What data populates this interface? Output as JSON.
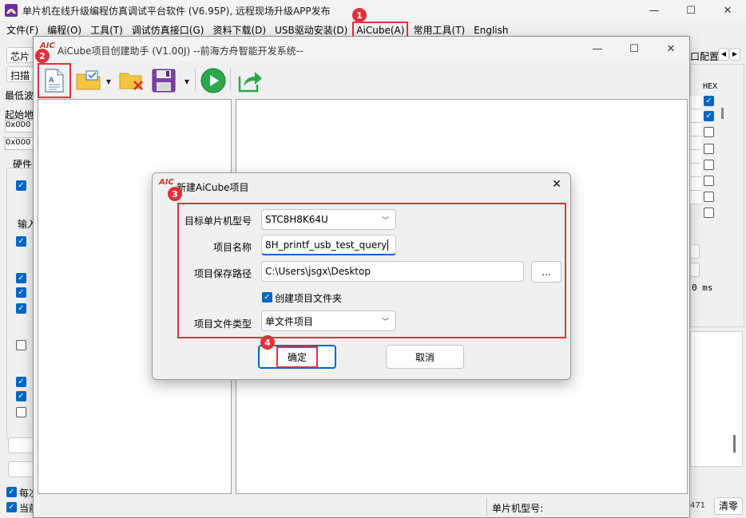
{
  "main_window": {
    "title": "单片机在线升级编程仿真调试平台软件 (V6.95P), 远程现场升级APP发布",
    "menu": [
      "文件(F)",
      "编程(O)",
      "工具(T)",
      "调试仿真接口(G)",
      "资料下载(D)",
      "USB驱动安装(D)",
      "AiCube(A)",
      "常用工具(T)",
      "English"
    ],
    "left_fragments": [
      "芯片",
      "扫描",
      "最低波",
      "起始地",
      "0x000",
      "0x000",
      "硬件",
      "输入"
    ],
    "right_fragments": {
      "port_config": "口配置",
      "hex": "HEX",
      "ms": "0 ms",
      "count": "471",
      "clear": "清零"
    },
    "bottom_fragments": [
      "每次",
      "当前"
    ],
    "status_chip_label": "单片机型号:"
  },
  "assistant": {
    "logo": "AIC",
    "title": "AiCube项目创建助手 (V1.00J) --前海方舟智能开发系统--"
  },
  "dialog": {
    "logo": "AIC",
    "title": "新建AiCube项目",
    "fields": {
      "mcu_label": "目标单片机型号",
      "mcu_value": "STC8H8K64U",
      "name_label": "项目名称",
      "name_value": "8H_printf_usb_test_query",
      "path_label": "项目保存路径",
      "path_value": "C:\\Users\\jsgx\\Desktop",
      "browse_label": "...",
      "create_folder_label": "创建项目文件夹",
      "create_folder_checked": true,
      "type_label": "项目文件类型",
      "type_value": "单文件项目"
    },
    "ok_label": "确定",
    "cancel_label": "取消"
  },
  "badges": [
    "1",
    "2",
    "3",
    "4"
  ],
  "colors": {
    "highlight": "#e0313a",
    "accent": "#0067c0"
  }
}
